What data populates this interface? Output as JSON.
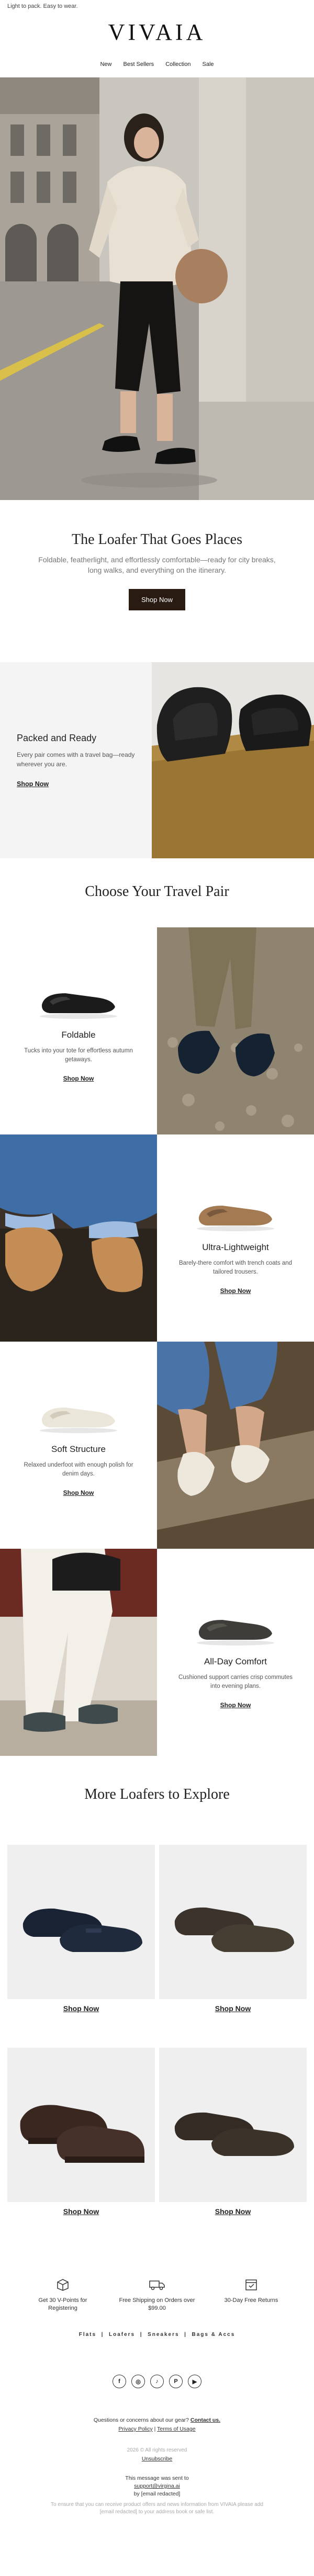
{
  "preheader": "Light to pack. Easy to wear.",
  "brand": {
    "logo": "VIVAIA"
  },
  "nav": {
    "items": [
      "New",
      "Best Sellers",
      "Collection",
      "Sale"
    ]
  },
  "intro": {
    "title": "The Loafer That Goes Places",
    "body": "Foldable, featherlight, and effortlessly comfortable—ready for city breaks, long walks, and everything on the itinerary.",
    "cta": "Shop Now"
  },
  "packed": {
    "title": "Packed and Ready",
    "body": "Every pair comes with a travel bag—ready wherever you are.",
    "cta": "Shop Now"
  },
  "choose": {
    "title": "Choose Your Travel Pair",
    "items": [
      {
        "name": "Foldable",
        "desc": "Tucks into your tote for effortless autumn getaways.",
        "cta": "Shop Now"
      },
      {
        "name": "Ultra-Lightweight",
        "desc": "Barely-there comfort with trench coats and tailored trousers.",
        "cta": "Shop Now"
      },
      {
        "name": "Soft Structure",
        "desc": "Relaxed underfoot with enough polish for denim days.",
        "cta": "Shop Now"
      },
      {
        "name": "All-Day Comfort",
        "desc": "Cushioned support carries crisp commutes into evening plans.",
        "cta": "Shop Now"
      }
    ]
  },
  "more": {
    "title": "More Loafers to Explore",
    "items": [
      {
        "cta": "Shop Now"
      },
      {
        "cta": "Shop Now"
      },
      {
        "cta": "Shop Now"
      },
      {
        "cta": "Shop Now"
      }
    ]
  },
  "benefits": [
    {
      "icon": "points-box-icon",
      "text": "Get 30 V-Points for Registering"
    },
    {
      "icon": "delivery-truck-icon",
      "text": "Free Shipping on Orders over $99.00"
    },
    {
      "icon": "returns-calendar-icon",
      "text": "30-Day Free Returns"
    }
  ],
  "footer": {
    "links": [
      "Flats",
      "Loafers",
      "Sneakers",
      "Bags & Accs"
    ],
    "separator": "|",
    "socials": [
      {
        "icon": "facebook-icon",
        "glyph": "f"
      },
      {
        "icon": "instagram-icon",
        "glyph": "◎"
      },
      {
        "icon": "tiktok-icon",
        "glyph": "♪"
      },
      {
        "icon": "pinterest-icon",
        "glyph": "P"
      },
      {
        "icon": "youtube-icon",
        "glyph": "▶"
      }
    ],
    "question": "Questions or concerns about our gear?",
    "contact": "Contact us.",
    "privacy": "Privacy Policy",
    "pipe": "|",
    "terms": "Terms of Usage",
    "copyright": "2026 © All rights reserved",
    "unsubscribe": "Unsubscribe",
    "sent_to_1": "This message was sent to",
    "sent_to_2": "support@virgina.ai",
    "sent_to_3": "by [email redacted]",
    "disclaimer": "To ensure that you can receive product offers and news information from VIVAIA please add [email redacted] to your address book or safe list."
  },
  "colors": {
    "cta_dark": "#2a1b12",
    "panel_bg": "#f4f4f4",
    "grid_bg": "#efefef"
  }
}
